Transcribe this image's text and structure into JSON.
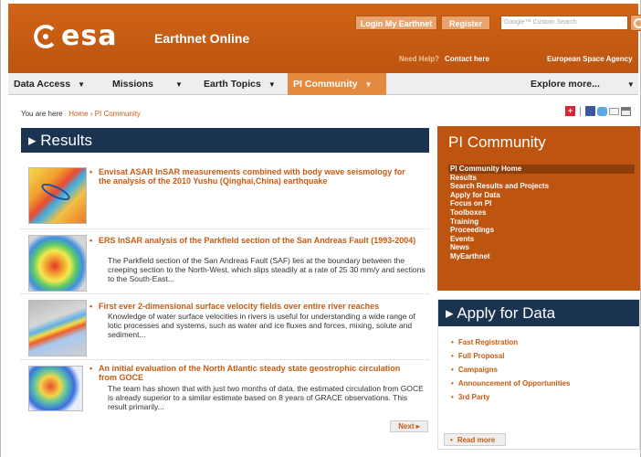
{
  "header": {
    "logo": "esa",
    "site_name": "Earthnet Online",
    "login_label": "Login My Earthnet",
    "register_label": "Register",
    "search_placeholder": "Google™ Custom Search",
    "need_help": "Need Help?",
    "contact": "Contact here",
    "agency": "European Space Agency",
    "brand_color": "#c75b12",
    "navy_color": "#1a3350"
  },
  "nav": {
    "items": [
      "Data Access",
      "Missions",
      "Earth Topics",
      "PI Community"
    ],
    "explore": "Explore more..."
  },
  "breadcrumb": {
    "prefix": "You are here",
    "home": "Home",
    "current": "PI Community",
    "separator": "›"
  },
  "results": {
    "title": "Results",
    "items": [
      {
        "title": "Envisat ASAR InSAR measurements combined with body wave seismology for the analysis of the 2010 Yushu (Qinghai,China) earthquake",
        "desc": ""
      },
      {
        "title": "ERS InSAR analysis of the Parkfield section of the San Andreas Fault (1993-2004)",
        "desc": "The Parkfield section of the San Andreas Fault (SAF) lies at the boundary between the creeping section to the North-West, which slips steadily at a rate of 25 30 mm/y and sections to the South-East..."
      },
      {
        "title": "First ever 2-dimensional surface velocity fields over entire river reaches",
        "desc": "Knowledge of water surface velocities in rivers is useful for understanding a wide range of lotic processes and systems, such as water and ice fluxes and forces, mixing, solute and sediment..."
      },
      {
        "title": "An initial evaluation of the North Atlantic steady state geostrophic circulation from GOCE",
        "desc": "The team has shown that with just two months of data, the estimated circulation from GOCE is already superior to a similar estimate based on 8 years of GRACE observations. This result primarily..."
      }
    ],
    "next_label": "Next"
  },
  "pi_community": {
    "title": "PI Community",
    "links": [
      "PI Community Home",
      "Results",
      "Search Results and Projects",
      "Apply for Data",
      "Focus on PI",
      "Toolboxes",
      "Training",
      "Proceedings",
      "Events",
      "News",
      "MyEarthnet"
    ]
  },
  "apply": {
    "title": "Apply for Data",
    "links": [
      "Fast Registration",
      "Full Proposal",
      "Campaigns",
      "Announcement of Opportunities",
      "3rd Party"
    ],
    "read_more": "Read more"
  }
}
